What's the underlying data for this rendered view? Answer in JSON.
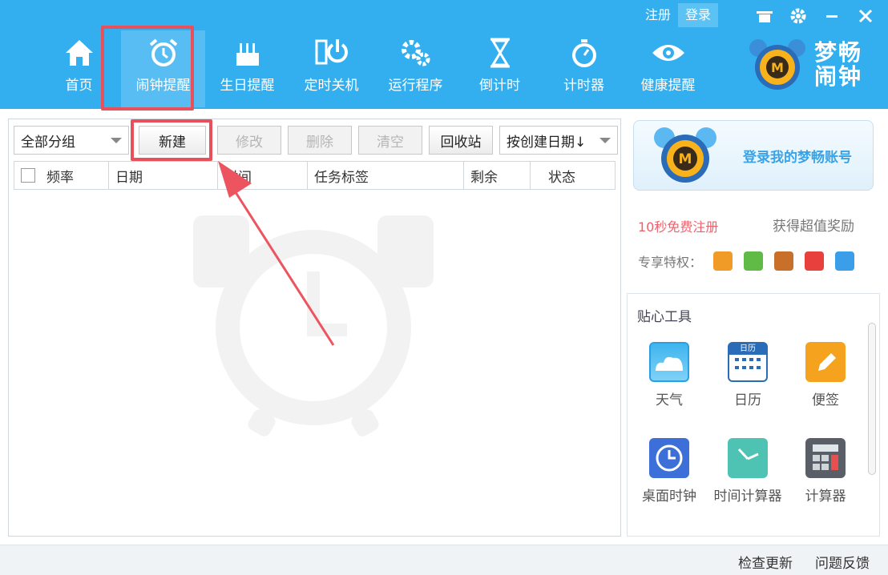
{
  "topbar": {
    "register_label": "注册",
    "login_label": "登录"
  },
  "nav": {
    "items": [
      {
        "label": "首页",
        "icon": "home-icon"
      },
      {
        "label": "闹钟提醒",
        "icon": "alarm-clock-icon"
      },
      {
        "label": "生日提醒",
        "icon": "birthday-cake-icon"
      },
      {
        "label": "定时关机",
        "icon": "power-icon"
      },
      {
        "label": "运行程序",
        "icon": "gears-icon"
      },
      {
        "label": "倒计时",
        "icon": "hourglass-icon"
      },
      {
        "label": "计时器",
        "icon": "stopwatch-icon"
      },
      {
        "label": "健康提醒",
        "icon": "eye-icon"
      }
    ],
    "active_index": 1
  },
  "logo": {
    "line1": "梦畅",
    "line2": "闹钟"
  },
  "toolbar": {
    "group_select": "全部分组",
    "new_label": "新建",
    "edit_label": "修改",
    "delete_label": "删除",
    "clear_label": "清空",
    "recycle_label": "回收站",
    "sort_select": "按创建日期↓"
  },
  "table": {
    "columns": [
      "频率",
      "日期",
      "时间",
      "任务标签",
      "剩余",
      "状态"
    ]
  },
  "account": {
    "login_prompt": "登录我的梦畅账号",
    "register_promo": "10秒免费注册",
    "reward": "获得超值奖励",
    "privileges_label": "专享特权："
  },
  "tools": {
    "title": "贴心工具",
    "items": [
      {
        "label": "天气",
        "icon": "weather-icon"
      },
      {
        "label": "日历",
        "icon": "calendar-icon"
      },
      {
        "label": "便签",
        "icon": "note-pencil-icon"
      },
      {
        "label": "桌面时钟",
        "icon": "desktop-clock-icon"
      },
      {
        "label": "时间计算器",
        "icon": "time-calculator-icon"
      },
      {
        "label": "计算器",
        "icon": "calculator-icon"
      }
    ],
    "calendar_icon_text": "日历"
  },
  "status": {
    "check_update": "检查更新",
    "feedback": "问题反馈"
  },
  "colors": {
    "header": "#33aff0",
    "highlight": "#e8505b",
    "promo": "#f0606a",
    "login_text": "#3aa3e6"
  }
}
